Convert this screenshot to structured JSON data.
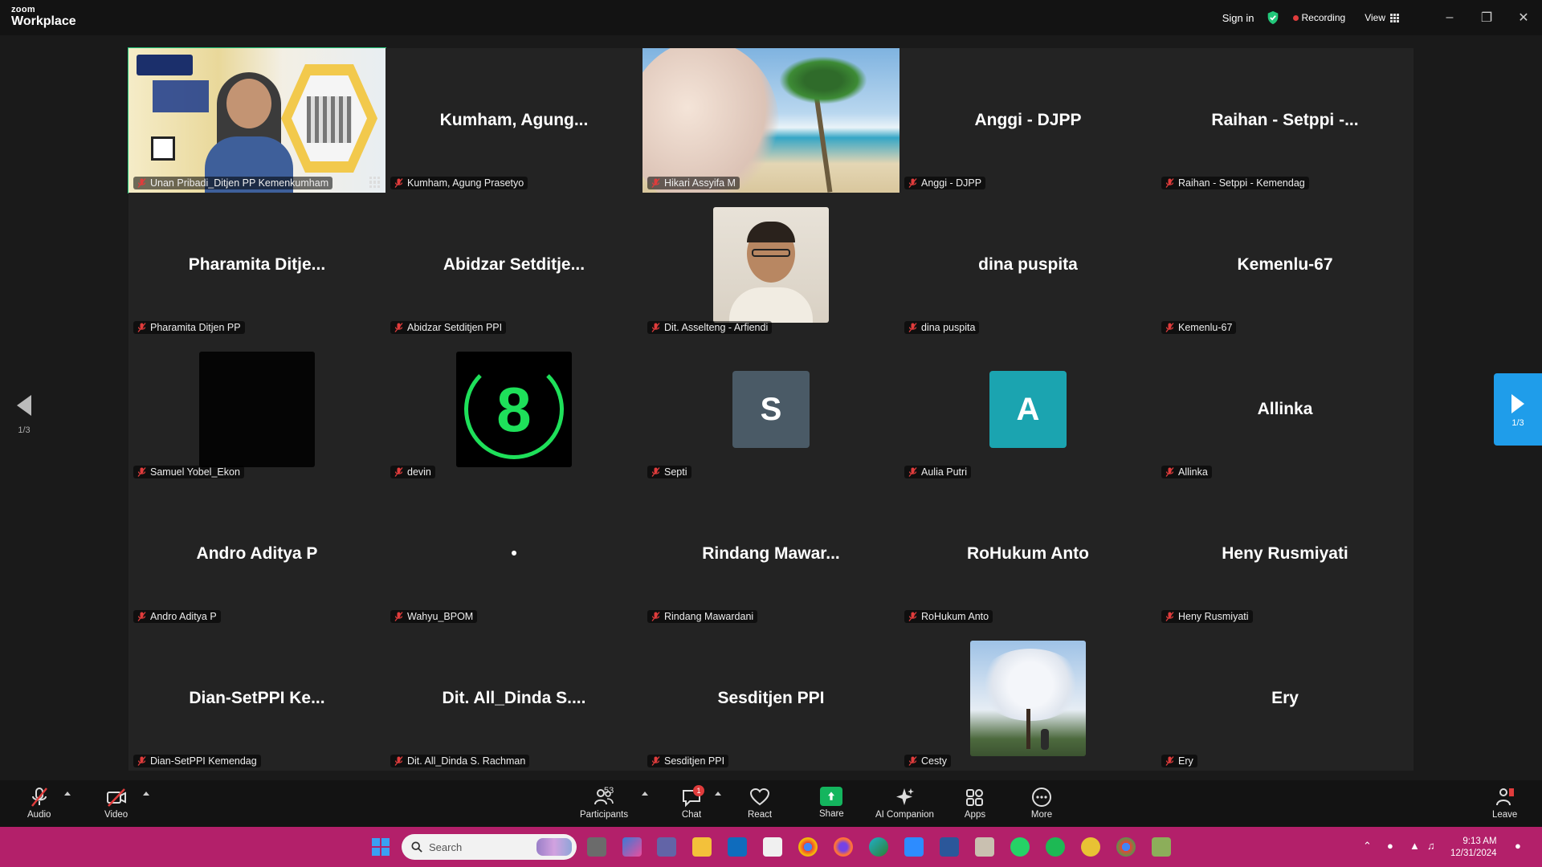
{
  "window": {
    "logo_small": "zoom",
    "logo_main": "Workplace",
    "sign_in": "Sign in",
    "recording": "Recording",
    "view": "View"
  },
  "gallery": {
    "page_indicator_left": "1/3",
    "page_indicator_right": "1/3",
    "tiles": [
      {
        "label": "Unan Pribadi_Ditjen PP Kemenkumham",
        "display": "",
        "kind": "video-slide",
        "active": true
      },
      {
        "label": "Kumham, Agung Prasetyo",
        "display": "Kumham,  Agung...",
        "kind": "name"
      },
      {
        "label": "Hikari Assyifa M",
        "display": "",
        "kind": "video-beach"
      },
      {
        "label": "Anggi - DJPP",
        "display": "Anggi - DJPP",
        "kind": "name"
      },
      {
        "label": "Raihan - Setppi - Kemendag",
        "display": "Raihan - Setppi -...",
        "kind": "name"
      },
      {
        "label": "Pharamita Ditjen PP",
        "display": "Pharamita Ditje...",
        "kind": "name"
      },
      {
        "label": "Abidzar Setditjen PPI",
        "display": "Abidzar Setditje...",
        "kind": "name"
      },
      {
        "label": "Dit. Asselteng - Arfiendi",
        "display": "",
        "kind": "photo-man"
      },
      {
        "label": "dina puspita",
        "display": "dina puspita",
        "kind": "name"
      },
      {
        "label": "Kemenlu-67",
        "display": "Kemenlu-67",
        "kind": "name"
      },
      {
        "label": "Samuel Yobel_Ekon",
        "display": "",
        "kind": "photo-black"
      },
      {
        "label": "devin",
        "display": "8",
        "kind": "photo-eight"
      },
      {
        "label": "Septi",
        "display": "S",
        "kind": "avatar",
        "color": "#4a5a66"
      },
      {
        "label": "Aulia Putri",
        "display": "A",
        "kind": "avatar",
        "color": "#1ba4b0"
      },
      {
        "label": "Allinka",
        "display": "Allinka",
        "kind": "name"
      },
      {
        "label": "Andro Aditya P",
        "display": "Andro Aditya P",
        "kind": "name"
      },
      {
        "label": "Wahyu_BPOM",
        "display": "•",
        "kind": "name"
      },
      {
        "label": "Rindang Mawardani",
        "display": "Rindang  Mawar...",
        "kind": "name"
      },
      {
        "label": "RoHukum Anto",
        "display": "RoHukum Anto",
        "kind": "name"
      },
      {
        "label": "Heny Rusmiyati",
        "display": "Heny Rusmiyati",
        "kind": "name"
      },
      {
        "label": "Dian-SetPPI Kemendag",
        "display": "Dian-SetPPI  Ke...",
        "kind": "name"
      },
      {
        "label": "Dit. All_Dinda S. Rachman",
        "display": "Dit. All_Dinda S....",
        "kind": "name"
      },
      {
        "label": "Sesditjen PPI",
        "display": "Sesditjen PPI",
        "kind": "name"
      },
      {
        "label": "Cesty",
        "display": "",
        "kind": "photo-tree"
      },
      {
        "label": "Ery",
        "display": "Ery",
        "kind": "name"
      }
    ]
  },
  "toolbar": {
    "audio": "Audio",
    "video": "Video",
    "participants": "Participants",
    "participants_count": "53",
    "chat": "Chat",
    "chat_badge": "1",
    "react": "React",
    "share": "Share",
    "ai": "AI Companion",
    "apps": "Apps",
    "more": "More",
    "leave": "Leave"
  },
  "taskbar": {
    "search_placeholder": "Search",
    "time": "9:13 AM",
    "date": "12/31/2024"
  },
  "colors": {
    "active_speaker": "#22c77a",
    "page_button": "#1f9dea",
    "taskbar": "#b3206a",
    "recording": "#e03c3c"
  }
}
